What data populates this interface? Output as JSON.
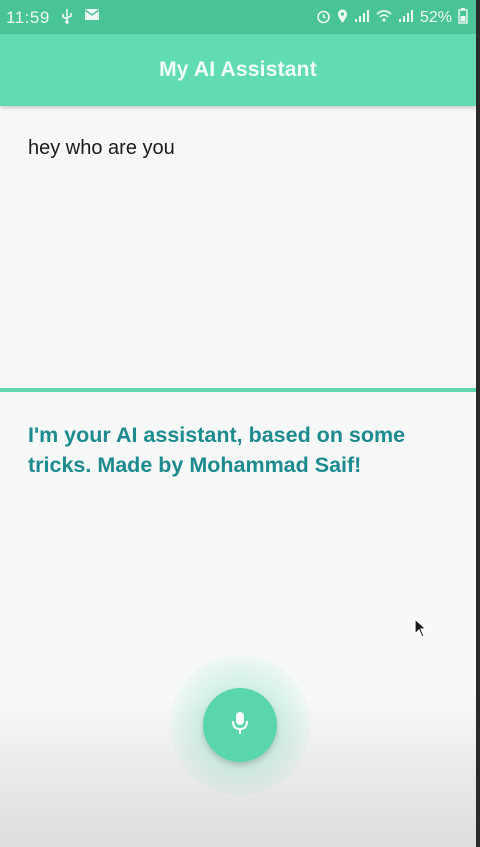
{
  "status_bar": {
    "time": "11:59",
    "battery": "52%",
    "left_icons": [
      "usb-icon",
      "mail-icon"
    ],
    "right_icons": [
      "alarm-icon",
      "location-icon",
      "signal-icon",
      "wifi-icon",
      "signal-icon",
      "battery-icon"
    ]
  },
  "app_bar": {
    "title": "My AI Assistant"
  },
  "conversation": {
    "user_query": "hey who are you",
    "assistant_response": "I'm your AI assistant, based on some tricks. Made by Mohammad Saif!"
  },
  "controls": {
    "mic_icon": "microphone-icon"
  },
  "colors": {
    "status_bar": "#49c496",
    "app_bar": "#61dcb0",
    "divider": "#5fd9ae",
    "response_text": "#1c8a8f",
    "mic_button": "#5ad6ac"
  }
}
